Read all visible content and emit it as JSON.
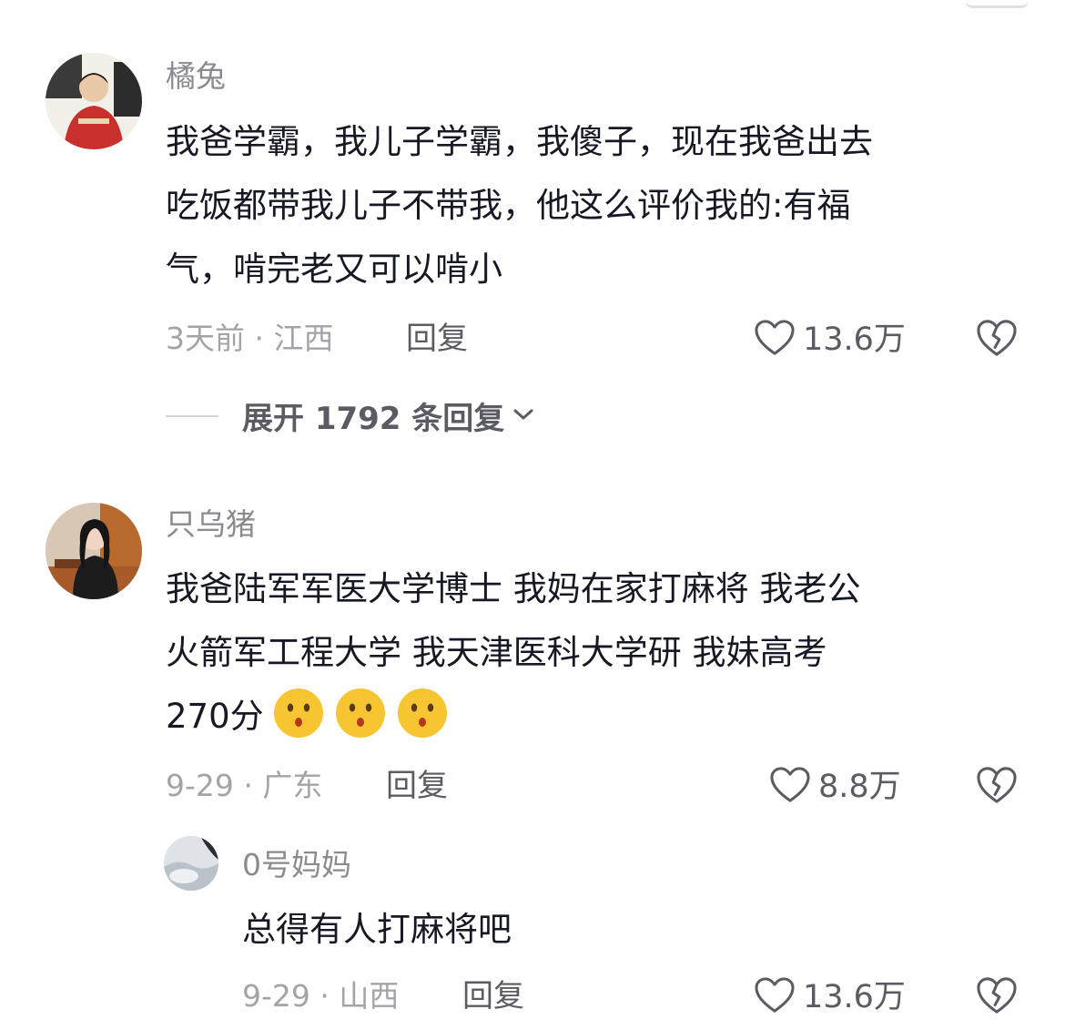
{
  "comments": [
    {
      "username": "橘兔",
      "lines": [
        "我爸学霸，我儿子学霸，我傻子，现在我爸出去",
        "吃饭都带我儿子不带我，他这么评价我的:有福",
        "气，啃完老又可以啃小"
      ],
      "time_location": "3天前 · 江西",
      "reply_label": "回复",
      "likes": "13.6万",
      "expand_label": "展开 1792 条回复"
    },
    {
      "username": "只乌猪",
      "lines": [
        "我爸陆军军医大学博士  我妈在家打麻将 我老公",
        "火箭军工程大学 我天津医科大学研  我妹高考"
      ],
      "last_line_text": "270分",
      "emoji_count": 3,
      "time_location": "9-29 · 广东",
      "reply_label": "回复",
      "likes": "8.8万"
    },
    {
      "username": "0号妈妈",
      "lines": [
        "总得有人打麻将吧"
      ],
      "time_location": "9-29 · 山西",
      "reply_label": "回复",
      "likes": "13.6万"
    }
  ],
  "icons": {
    "like": "heart-outline-icon",
    "dislike": "broken-heart-icon",
    "expand": "chevron-down-icon",
    "emoji": "surprised-face-emoji"
  },
  "colors": {
    "text_primary": "#161823",
    "text_secondary": "#8a8b91",
    "text_meta": "#a3a4aa",
    "action": "#5b5c63",
    "emoji_yellow": "#f7c531"
  }
}
